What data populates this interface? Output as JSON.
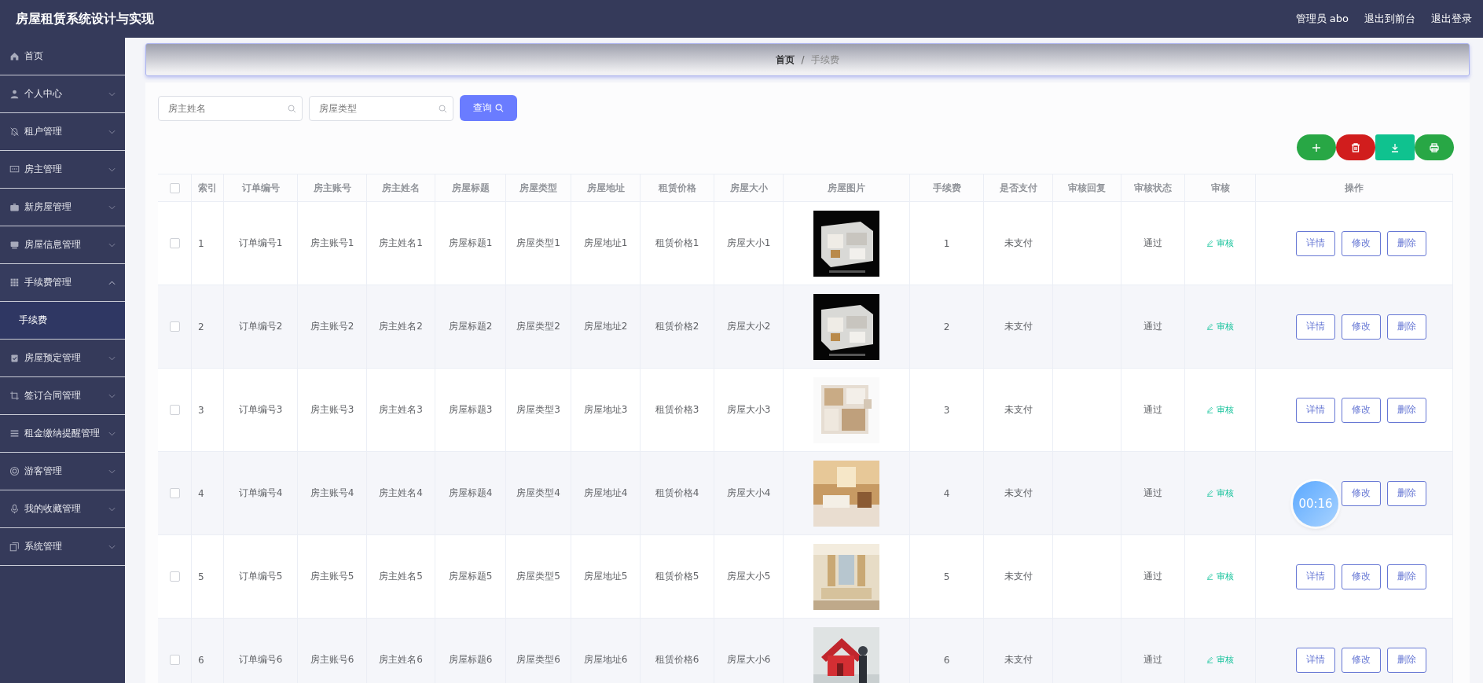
{
  "header": {
    "title": "房屋租赁系统设计与实现",
    "user": "管理员 abo",
    "links": [
      "退出到前台",
      "退出登录"
    ]
  },
  "sidebar": {
    "items": [
      {
        "label": "首页"
      },
      {
        "label": "个人中心",
        "expanded": false
      },
      {
        "label": "租户管理",
        "expanded": false
      },
      {
        "label": "房主管理",
        "expanded": false
      },
      {
        "label": "新房屋管理",
        "expanded": false
      },
      {
        "label": "房屋信息管理",
        "expanded": false
      },
      {
        "label": "手续费管理",
        "expanded": true,
        "children": [
          {
            "label": "手续费",
            "selected": true
          }
        ]
      },
      {
        "label": "房屋预定管理",
        "expanded": false
      },
      {
        "label": "签订合同管理",
        "expanded": false
      },
      {
        "label": "租金缴纳提醒管理",
        "expanded": false
      },
      {
        "label": "游客管理",
        "expanded": false
      },
      {
        "label": "我的收藏管理",
        "expanded": false
      },
      {
        "label": "系统管理",
        "expanded": false
      }
    ]
  },
  "breadcrumb": {
    "items": [
      "首页",
      "手续费"
    ],
    "separator": "/"
  },
  "search": {
    "fields": [
      {
        "placeholder": "房主姓名"
      },
      {
        "placeholder": "房屋类型"
      }
    ],
    "button": "查询"
  },
  "toolbar": [
    {
      "kind": "add"
    },
    {
      "kind": "delete"
    },
    {
      "kind": "export"
    },
    {
      "kind": "print"
    }
  ],
  "table": {
    "select_all_checked": false,
    "columns": [
      "索引",
      "订单编号",
      "房主账号",
      "房主姓名",
      "房屋标题",
      "房屋类型",
      "房屋地址",
      "租赁价格",
      "房屋大小",
      "房屋图片",
      "手续费",
      "是否支付",
      "审核回复",
      "审核状态",
      "审核",
      "操作"
    ],
    "rows": [
      {
        "checked": false,
        "cells": [
          "1",
          "订单编号1",
          "房主账号1",
          "房主姓名1",
          "房屋标题1",
          "房屋类型1",
          "房屋地址1",
          "租赁价格1",
          "房屋大小1"
        ],
        "picture": {
          "kind": "picture"
        },
        "fee": "1",
        "paid": "未支付",
        "status": "通过",
        "review": "审核",
        "actions": [
          "详情",
          "修改",
          "删除"
        ]
      },
      {
        "checked": false,
        "cells": [
          "2",
          "订单编号2",
          "房主账号2",
          "房主姓名2",
          "房屋标题2",
          "房屋类型2",
          "房屋地址2",
          "租赁价格2",
          "房屋大小2"
        ],
        "picture": {
          "kind": "picture"
        },
        "fee": "2",
        "paid": "未支付",
        "status": "通过",
        "review": "审核",
        "actions": [
          "详情",
          "修改",
          "删除"
        ]
      },
      {
        "checked": false,
        "cells": [
          "3",
          "订单编号3",
          "房主账号3",
          "房主姓名3",
          "房屋标题3",
          "房屋类型3",
          "房屋地址3",
          "租赁价格3",
          "房屋大小3"
        ],
        "picture": {
          "kind": "picture"
        },
        "fee": "3",
        "paid": "未支付",
        "status": "通过",
        "review": "审核",
        "actions": [
          "详情",
          "修改",
          "删除"
        ]
      },
      {
        "checked": false,
        "cells": [
          "4",
          "订单编号4",
          "房主账号4",
          "房主姓名4",
          "房屋标题4",
          "房屋类型4",
          "房屋地址4",
          "租赁价格4",
          "房屋大小4"
        ],
        "picture": {
          "kind": "picture"
        },
        "fee": "4",
        "paid": "未支付",
        "status": "通过",
        "review": "审核",
        "actions": [
          {
            "kind": "edit",
            "label": "修改"
          },
          {
            "kind": "delete",
            "label": "删除"
          }
        ]
      },
      {
        "checked": false,
        "cells": [
          "5",
          "订单编号5",
          "房主账号5",
          "房主姓名5",
          "房屋标题5",
          "房屋类型5",
          "房屋地址5",
          "租赁价格5",
          "房屋大小5"
        ],
        "picture": {
          "kind": "picture"
        },
        "fee": "5",
        "paid": "未支付",
        "status": "通过",
        "review": "审核",
        "actions": [
          "详情",
          "修改",
          "删除"
        ]
      },
      {
        "checked": false,
        "cells": [
          "6",
          "订单编号6",
          "房主账号6",
          "房主姓名6",
          "房屋标题6",
          "房屋类型6",
          "房屋地址6",
          "租赁价格6",
          "房屋大小6"
        ],
        "picture": {
          "kind": "picture"
        },
        "fee": "6",
        "paid": "未支付",
        "status": "通过",
        "review": "审核",
        "actions": [
          "详情",
          "修改",
          "删除"
        ]
      }
    ]
  },
  "recording_timer": "00:16"
}
